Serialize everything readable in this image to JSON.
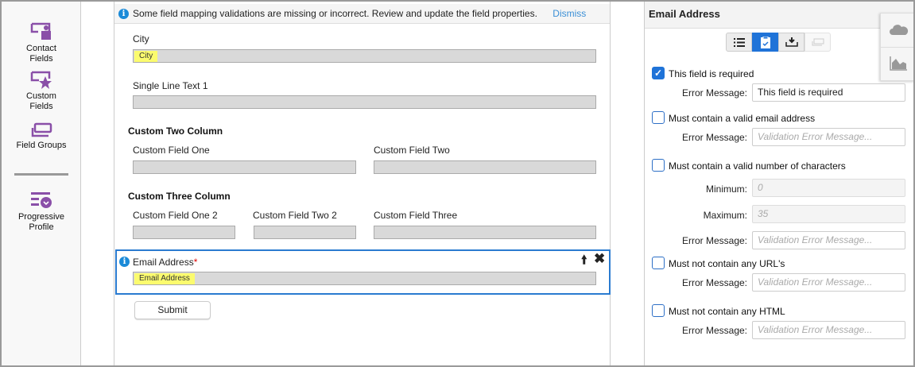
{
  "sidebar": {
    "items": [
      {
        "label_1": "Contact",
        "label_2": "Fields"
      },
      {
        "label_1": "Custom",
        "label_2": "Fields"
      },
      {
        "label_1": "Field Groups"
      },
      {
        "label_1": "Progressive",
        "label_2": "Profile"
      }
    ]
  },
  "banner": {
    "message": "Some field mapping validations are missing or incorrect. Review and update the field properties.",
    "dismiss": "Dismiss"
  },
  "form": {
    "city": {
      "label": "City",
      "value": "City"
    },
    "single_line": {
      "label": "Single Line Text 1"
    },
    "two_col": {
      "heading": "Custom Two Column",
      "f1": "Custom Field One",
      "f2": "Custom Field Two"
    },
    "three_col": {
      "heading": "Custom Three Column",
      "f1": "Custom Field One 2",
      "f2": "Custom Field Two 2",
      "f3": "Custom Field Three"
    },
    "email": {
      "label": "Email Address",
      "required": "*",
      "value": "Email Address"
    },
    "submit": "Submit"
  },
  "panel": {
    "title": "Email Address",
    "rules": [
      {
        "label": "This field is required",
        "checked": true,
        "error_label": "Error Message:",
        "error_value": "This field is required"
      },
      {
        "label": "Must contain a valid email address",
        "checked": false,
        "error_label": "Error Message:",
        "error_placeholder": "Validation Error Message..."
      },
      {
        "label": "Must contain a valid number of characters",
        "checked": false,
        "min_label": "Minimum:",
        "min_placeholder": "0",
        "max_label": "Maximum:",
        "max_placeholder": "35",
        "error_label": "Error Message:",
        "error_placeholder": "Validation Error Message..."
      },
      {
        "label": "Must not contain any URL's",
        "checked": false,
        "error_label": "Error Message:",
        "error_placeholder": "Validation Error Message..."
      },
      {
        "label": "Must not contain any HTML",
        "checked": false,
        "error_label": "Error Message:",
        "error_placeholder": "Validation Error Message..."
      }
    ]
  },
  "colors": {
    "accent": "#1f73d8",
    "purple": "#8a4fa8",
    "highlight": "#fbfb6e"
  }
}
